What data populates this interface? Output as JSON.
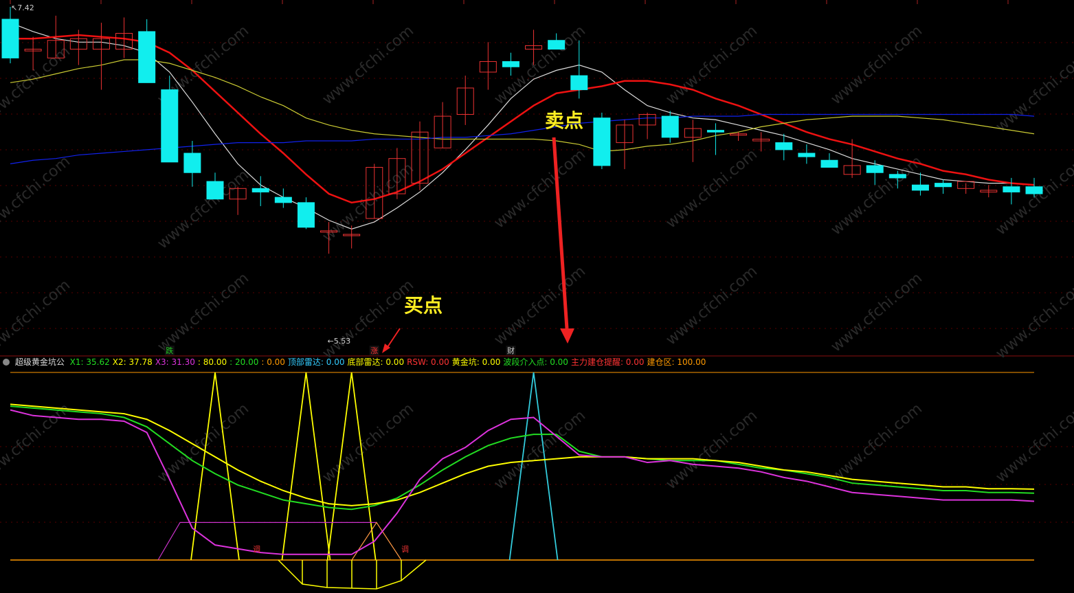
{
  "price_panel": {
    "high_label": "7.42",
    "low_label": "5.53",
    "annotation_buy": "买点",
    "annotation_sell": "卖点",
    "signals": [
      {
        "index": 7,
        "text": "跌",
        "color": "#22cc22"
      },
      {
        "index": 16,
        "text": "涨",
        "color": "#ff3333"
      },
      {
        "index": 22,
        "text": "财",
        "color": "#cccccc"
      }
    ]
  },
  "indicator_bar": {
    "name": "超级黄金坑公",
    "items": [
      {
        "text": "X1: 35.62",
        "color": "#22dd22"
      },
      {
        "text": "X2: 37.78",
        "color": "#ffff00"
      },
      {
        "text": "X3: 31.30",
        "color": "#dd33dd"
      },
      {
        "text": ": 80.00",
        "color": "#ffff00"
      },
      {
        "text": ": 20.00",
        "color": "#22dd22"
      },
      {
        "text": ": 0.00",
        "color": "#ff9900"
      },
      {
        "text": "顶部雷达: 0.00",
        "color": "#33ccff"
      },
      {
        "text": "底部雷达: 0.00",
        "color": "#ffff00"
      },
      {
        "text": "RSW: 0.00",
        "color": "#ff3333"
      },
      {
        "text": "黄金坑: 0.00",
        "color": "#ffff00"
      },
      {
        "text": "波段介入点: 0.00",
        "color": "#22dd22"
      },
      {
        "text": "主力建仓提醒: 0.00",
        "color": "#ff3333"
      },
      {
        "text": "建仓区: 100.00",
        "color": "#ff9900"
      }
    ]
  },
  "indicator_labels": {
    "left": "调",
    "right": "调"
  },
  "watermark": "www.cfchi.com",
  "chart_data": [
    {
      "type": "candlestick",
      "ylim": [
        5.53,
        7.42
      ],
      "candles": [
        {
          "o": 7.35,
          "h": 7.42,
          "l": 7.1,
          "c": 7.13
        },
        {
          "o": 7.17,
          "h": 7.25,
          "l": 7.06,
          "c": 7.18
        },
        {
          "o": 7.13,
          "h": 7.37,
          "l": 7.13,
          "c": 7.23
        },
        {
          "o": 7.18,
          "h": 7.29,
          "l": 7.09,
          "c": 7.24
        },
        {
          "o": 7.18,
          "h": 7.33,
          "l": 6.95,
          "c": 7.24
        },
        {
          "o": 7.18,
          "h": 7.36,
          "l": 7.13,
          "c": 7.27
        },
        {
          "o": 7.28,
          "h": 7.35,
          "l": 6.99,
          "c": 6.99
        },
        {
          "o": 6.95,
          "h": 7.03,
          "l": 6.54,
          "c": 6.54
        },
        {
          "o": 6.59,
          "h": 6.66,
          "l": 6.4,
          "c": 6.48
        },
        {
          "o": 6.43,
          "h": 6.48,
          "l": 6.35,
          "c": 6.33
        },
        {
          "o": 6.33,
          "h": 6.4,
          "l": 6.24,
          "c": 6.39
        },
        {
          "o": 6.39,
          "h": 6.46,
          "l": 6.29,
          "c": 6.37
        },
        {
          "o": 6.34,
          "h": 6.39,
          "l": 6.28,
          "c": 6.31
        },
        {
          "o": 6.31,
          "h": 6.34,
          "l": 6.16,
          "c": 6.17
        },
        {
          "o": 6.15,
          "h": 6.2,
          "l": 6.02,
          "c": 6.15
        },
        {
          "o": 6.13,
          "h": 6.18,
          "l": 6.05,
          "c": 6.13
        },
        {
          "o": 6.22,
          "h": 6.53,
          "l": 6.22,
          "c": 6.51
        },
        {
          "o": 6.36,
          "h": 6.62,
          "l": 6.33,
          "c": 6.56
        },
        {
          "o": 6.42,
          "h": 6.77,
          "l": 6.38,
          "c": 6.71
        },
        {
          "o": 6.62,
          "h": 6.88,
          "l": 6.62,
          "c": 6.8
        },
        {
          "o": 6.81,
          "h": 7.03,
          "l": 6.75,
          "c": 6.96
        },
        {
          "o": 7.05,
          "h": 7.22,
          "l": 6.95,
          "c": 7.11
        },
        {
          "o": 7.11,
          "h": 7.16,
          "l": 7.03,
          "c": 7.08
        },
        {
          "o": 7.18,
          "h": 7.29,
          "l": 7.09,
          "c": 7.2
        },
        {
          "o": 7.23,
          "h": 7.27,
          "l": 7.19,
          "c": 7.18
        },
        {
          "o": 7.03,
          "h": 7.23,
          "l": 6.9,
          "c": 6.95
        },
        {
          "o": 6.79,
          "h": 6.82,
          "l": 6.5,
          "c": 6.52
        },
        {
          "o": 6.65,
          "h": 6.78,
          "l": 6.5,
          "c": 6.75
        },
        {
          "o": 6.75,
          "h": 6.82,
          "l": 6.67,
          "c": 6.81
        },
        {
          "o": 6.8,
          "h": 6.83,
          "l": 6.65,
          "c": 6.68
        },
        {
          "o": 6.68,
          "h": 6.78,
          "l": 6.54,
          "c": 6.73
        },
        {
          "o": 6.72,
          "h": 6.76,
          "l": 6.58,
          "c": 6.71
        },
        {
          "o": 6.7,
          "h": 6.71,
          "l": 6.66,
          "c": 6.7
        },
        {
          "o": 6.66,
          "h": 6.71,
          "l": 6.6,
          "c": 6.67
        },
        {
          "o": 6.65,
          "h": 6.7,
          "l": 6.55,
          "c": 6.61
        },
        {
          "o": 6.59,
          "h": 6.64,
          "l": 6.53,
          "c": 6.57
        },
        {
          "o": 6.55,
          "h": 6.59,
          "l": 6.53,
          "c": 6.51
        },
        {
          "o": 6.47,
          "h": 6.67,
          "l": 6.45,
          "c": 6.52
        },
        {
          "o": 6.52,
          "h": 6.55,
          "l": 6.41,
          "c": 6.48
        },
        {
          "o": 6.47,
          "h": 6.49,
          "l": 6.39,
          "c": 6.45
        },
        {
          "o": 6.41,
          "h": 6.48,
          "l": 6.35,
          "c": 6.38
        },
        {
          "o": 6.42,
          "h": 6.44,
          "l": 6.36,
          "c": 6.4
        },
        {
          "o": 6.39,
          "h": 6.42,
          "l": 6.36,
          "c": 6.43
        },
        {
          "o": 6.37,
          "h": 6.41,
          "l": 6.34,
          "c": 6.38
        },
        {
          "o": 6.4,
          "h": 6.45,
          "l": 6.3,
          "c": 6.37
        },
        {
          "o": 6.4,
          "h": 6.45,
          "l": 6.34,
          "c": 6.36
        }
      ],
      "ma": [
        {
          "name": "white",
          "color": "#dddddd",
          "values": [
            7.33,
            7.28,
            7.24,
            7.22,
            7.22,
            7.2,
            7.16,
            7.05,
            6.88,
            6.7,
            6.53,
            6.41,
            6.34,
            6.28,
            6.21,
            6.16,
            6.2,
            6.28,
            6.37,
            6.48,
            6.61,
            6.75,
            6.9,
            7.01,
            7.06,
            7.09,
            7.05,
            6.95,
            6.86,
            6.82,
            6.79,
            6.78,
            6.75,
            6.72,
            6.69,
            6.65,
            6.61,
            6.56,
            6.53,
            6.5,
            6.47,
            6.44,
            6.43,
            6.42,
            6.42,
            6.41
          ]
        },
        {
          "name": "red",
          "color": "#ee1111",
          "values": [
            7.24,
            7.24,
            7.25,
            7.26,
            7.25,
            7.24,
            7.22,
            7.16,
            7.06,
            6.94,
            6.82,
            6.7,
            6.59,
            6.47,
            6.36,
            6.31,
            6.33,
            6.37,
            6.43,
            6.5,
            6.59,
            6.68,
            6.77,
            6.86,
            6.93,
            6.95,
            6.97,
            7.0,
            7.0,
            6.98,
            6.95,
            6.9,
            6.86,
            6.81,
            6.76,
            6.71,
            6.67,
            6.64,
            6.6,
            6.56,
            6.53,
            6.49,
            6.47,
            6.44,
            6.42,
            6.41
          ]
        },
        {
          "name": "yellow",
          "color": "#cccc33",
          "values": [
            6.99,
            7.01,
            7.04,
            7.07,
            7.09,
            7.12,
            7.12,
            7.1,
            7.06,
            7.02,
            6.97,
            6.91,
            6.86,
            6.79,
            6.75,
            6.72,
            6.7,
            6.69,
            6.68,
            6.67,
            6.67,
            6.67,
            6.67,
            6.67,
            6.66,
            6.64,
            6.6,
            6.61,
            6.63,
            6.64,
            6.66,
            6.69,
            6.71,
            6.74,
            6.76,
            6.78,
            6.79,
            6.8,
            6.8,
            6.8,
            6.79,
            6.78,
            6.76,
            6.74,
            6.72,
            6.7
          ]
        },
        {
          "name": "blue",
          "color": "#1122ee",
          "values": [
            6.53,
            6.55,
            6.56,
            6.58,
            6.59,
            6.6,
            6.61,
            6.62,
            6.63,
            6.64,
            6.65,
            6.65,
            6.65,
            6.66,
            6.66,
            6.66,
            6.67,
            6.67,
            6.67,
            6.68,
            6.68,
            6.69,
            6.7,
            6.72,
            6.74,
            6.76,
            6.77,
            6.78,
            6.79,
            6.79,
            6.8,
            6.8,
            6.8,
            6.81,
            6.81,
            6.81,
            6.81,
            6.81,
            6.81,
            6.81,
            6.81,
            6.81,
            6.81,
            6.81,
            6.81,
            6.8
          ]
        }
      ]
    },
    {
      "type": "line",
      "ylim": [
        0,
        100
      ],
      "reference_lines": [
        100,
        80,
        20,
        0
      ],
      "series": [
        {
          "name": "X1",
          "color": "#22dd22",
          "values": [
            82,
            81,
            80,
            79,
            78,
            76,
            71,
            62,
            53,
            46,
            40,
            36,
            32,
            30,
            28,
            27,
            29,
            33,
            40,
            48,
            55,
            61,
            65,
            67,
            67,
            58,
            55,
            55,
            54,
            53,
            53,
            53,
            51,
            49,
            48,
            46,
            44,
            41,
            40,
            39,
            38,
            37,
            37,
            36,
            36,
            35.62
          ]
        },
        {
          "name": "X2",
          "color": "#ffff00",
          "values": [
            83,
            82,
            81,
            80,
            79,
            78,
            75,
            69,
            62,
            55,
            48,
            42,
            37,
            33,
            30,
            29,
            30,
            32,
            36,
            41,
            46,
            50,
            52,
            53,
            54,
            55,
            55,
            55,
            54,
            54,
            54,
            53,
            52,
            50,
            48,
            47,
            45,
            43,
            42,
            41,
            40,
            39,
            39,
            38,
            38,
            37.78
          ]
        },
        {
          "name": "X3",
          "color": "#dd33dd",
          "values": [
            80,
            77,
            76,
            75,
            75,
            74,
            68,
            43,
            17,
            8,
            6,
            4,
            3,
            3,
            3,
            3,
            10,
            25,
            43,
            54,
            60,
            69,
            75,
            76,
            66,
            56,
            55,
            55,
            52,
            53,
            51,
            50,
            49,
            47,
            44,
            42,
            39,
            36,
            35,
            34,
            33,
            32,
            32,
            32,
            32,
            31.3
          ]
        },
        {
          "name": "orange",
          "color": "#ff9900",
          "values": [
            0,
            0,
            0,
            0,
            0,
            0,
            0,
            20,
            20,
            20,
            20,
            20,
            20,
            20,
            20,
            20,
            20,
            20,
            20,
            20,
            20,
            20,
            20,
            20,
            20,
            20,
            20,
            20,
            20,
            20,
            20,
            20,
            20,
            20,
            20,
            20,
            20,
            20,
            20,
            20,
            20,
            20,
            20,
            20,
            20,
            20
          ]
        }
      ]
    }
  ]
}
